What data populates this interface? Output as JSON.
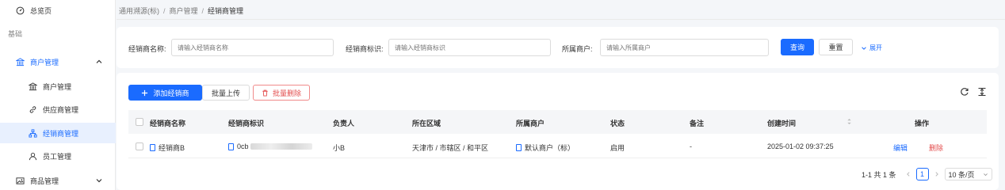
{
  "sidebar": {
    "overview": "总览页",
    "group_basic": "基础",
    "merchant_mgmt": "商户管理",
    "items": [
      {
        "label": "商户管理"
      },
      {
        "label": "供应商管理"
      },
      {
        "label": "经销商管理"
      },
      {
        "label": "员工管理"
      }
    ],
    "goods_mgmt": "商品管理"
  },
  "breadcrumb": [
    "通用溯源(标)",
    "商户管理",
    "经销商管理"
  ],
  "filter": {
    "name_label": "经销商名称:",
    "name_placeholder": "请输入经销商名称",
    "id_label": "经销商标识:",
    "id_placeholder": "请输入经销商标识",
    "merchant_label": "所属商户:",
    "merchant_placeholder": "请输入所属商户",
    "search": "查询",
    "reset": "重置",
    "expand": "展开"
  },
  "toolbar": {
    "add": "添加经销商",
    "batch_upload": "批量上传",
    "batch_delete": "批量删除"
  },
  "table": {
    "headers": [
      "经销商名称",
      "经销商标识",
      "负责人",
      "所在区域",
      "所属商户",
      "状态",
      "备注",
      "创建时间",
      "操作"
    ],
    "rows": [
      {
        "name": "经销商B",
        "id": "0cb",
        "owner": "小B",
        "region": "天津市 / 市辖区 / 和平区",
        "merchant": "默认商户（标）",
        "status": "启用",
        "note": "-",
        "created": "2025-01-02 09:37:25",
        "edit": "编辑",
        "delete": "删除"
      }
    ]
  },
  "pagination": {
    "summary": "1-1 共 1 条",
    "current": "1",
    "page_size": "10 条/页"
  },
  "colors": {
    "primary": "#1a6bff",
    "danger": "#e34d4d",
    "active_bg": "#e8f0fe"
  }
}
